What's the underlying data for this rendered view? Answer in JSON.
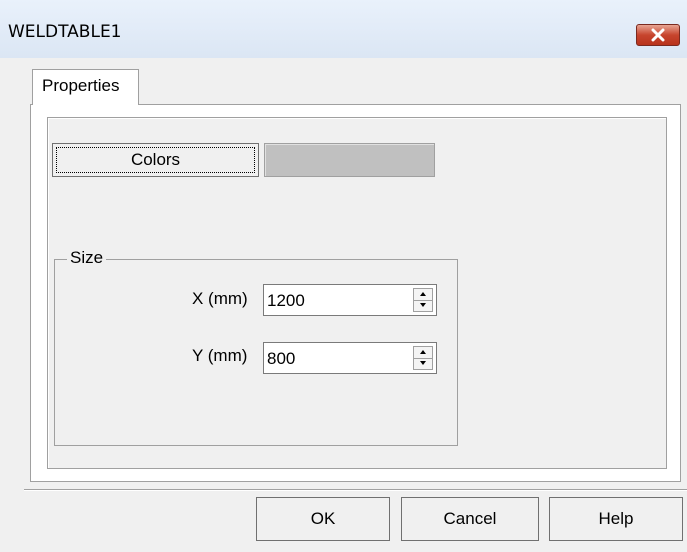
{
  "window": {
    "title": "WELDTABLE1"
  },
  "tabs": [
    {
      "label": "Properties",
      "selected": true
    }
  ],
  "colors": {
    "button_label": "Colors",
    "swatch_color": "#c0c0c0"
  },
  "size_group": {
    "label": "Size",
    "x": {
      "label": "X (mm)",
      "value": "1200"
    },
    "y": {
      "label": "Y (mm)",
      "value": "800"
    }
  },
  "buttons": {
    "ok": "OK",
    "cancel": "Cancel",
    "help": "Help"
  }
}
